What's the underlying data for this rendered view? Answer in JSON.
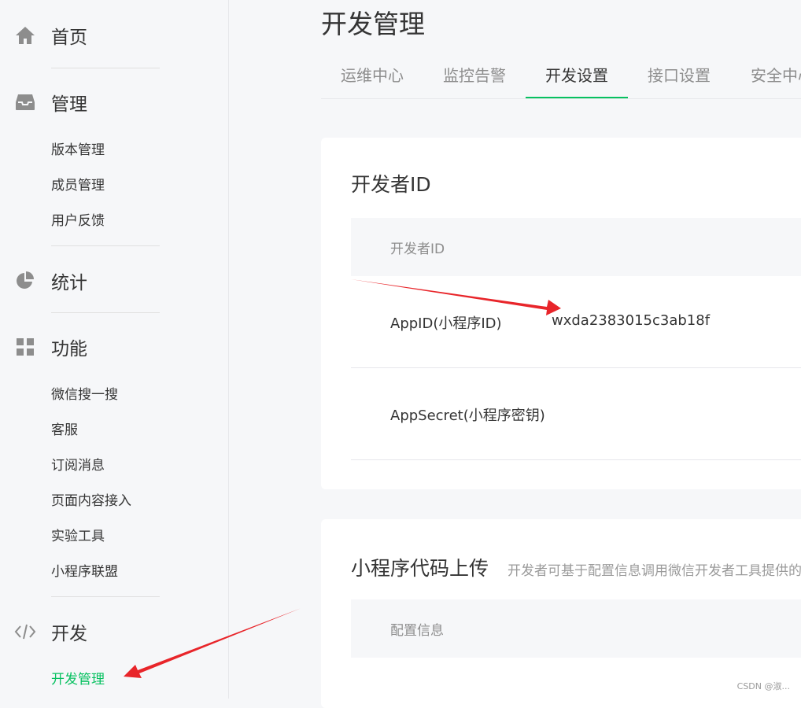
{
  "sidebar": {
    "home": "首页",
    "manage": "管理",
    "manage_items": [
      "版本管理",
      "成员管理",
      "用户反馈"
    ],
    "stats": "统计",
    "features": "功能",
    "feature_items": [
      "微信搜一搜",
      "客服",
      "订阅消息",
      "页面内容接入",
      "实验工具",
      "小程序联盟"
    ],
    "dev": "开发",
    "dev_items": [
      "开发管理"
    ]
  },
  "main": {
    "title": "开发管理",
    "tabs": [
      "运维中心",
      "监控告警",
      "开发设置",
      "接口设置",
      "安全中心"
    ],
    "active_tab": "开发设置",
    "dev_id_card": {
      "title": "开发者ID",
      "header": "开发者ID",
      "rows": [
        {
          "label": "AppID(小程序ID)",
          "value": "wxda2383015c3ab18f"
        },
        {
          "label": "AppSecret(小程序密钥)",
          "value": ""
        }
      ]
    },
    "upload_card": {
      "title": "小程序代码上传",
      "desc": "开发者可基于配置信息调用微信开发者工具提供的",
      "header": "配置信息"
    }
  },
  "watermark": "CSDN @淑...",
  "colors": {
    "accent": "#07c160",
    "arrow": "#e8252a"
  }
}
